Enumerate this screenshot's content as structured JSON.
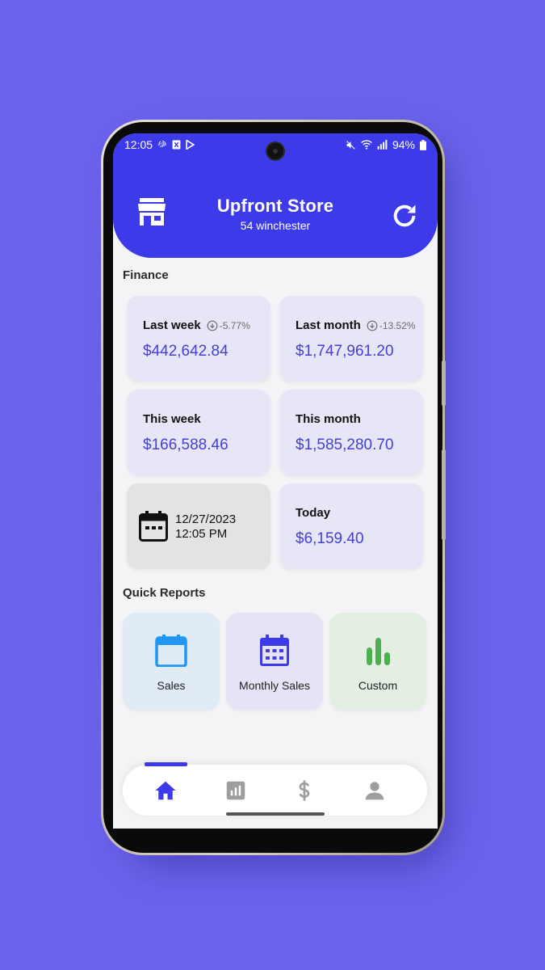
{
  "status_bar": {
    "time": "12:05",
    "battery": "94%",
    "left_icons": [
      "fingerprint-icon",
      "sim-icon",
      "play-icon"
    ],
    "right_icons": [
      "mute-icon",
      "wifi-icon",
      "signal-icon",
      "battery-icon"
    ]
  },
  "header": {
    "title": "Upfront Store",
    "subtitle": "54 winchester",
    "left_icon": "store-icon",
    "right_icon": "refresh-icon",
    "color": "#3d3ae9"
  },
  "finance": {
    "title": "Finance",
    "cards": [
      {
        "label": "Last week",
        "change": "-5.77%",
        "value": "$442,642.84"
      },
      {
        "label": "Last month",
        "change": "-13.52%",
        "value": "$1,747,961.20"
      },
      {
        "label": "This week",
        "value": "$166,588.46"
      },
      {
        "label": "This month",
        "value": "$1,585,280.70"
      },
      {
        "date": "12/27/2023",
        "time": "12:05 PM",
        "icon": "calendar-icon"
      },
      {
        "label": "Today",
        "value": "$6,159.40"
      }
    ]
  },
  "quick_reports": {
    "title": "Quick Reports",
    "items": [
      {
        "label": "Sales",
        "icon": "calendar-icon",
        "color": "#2196f3",
        "bg": "#e1ebf5"
      },
      {
        "label": "Monthly Sales",
        "icon": "calendar-month-icon",
        "color": "#3d3ae9",
        "bg": "#e5e4f6"
      },
      {
        "label": "Custom",
        "icon": "bar-chart-icon",
        "color": "#4caf50",
        "bg": "#e4efe4"
      }
    ]
  },
  "bottom_nav": {
    "items": [
      "home-icon",
      "analytics-icon",
      "dollar-icon",
      "person-icon"
    ],
    "active": "home-icon",
    "active_color": "#3d3ae9",
    "inactive_color": "#9e9e9e"
  },
  "colors": {
    "background": "#6b63ec",
    "accent": "#3d3ae9",
    "value_text": "#4440d2"
  }
}
